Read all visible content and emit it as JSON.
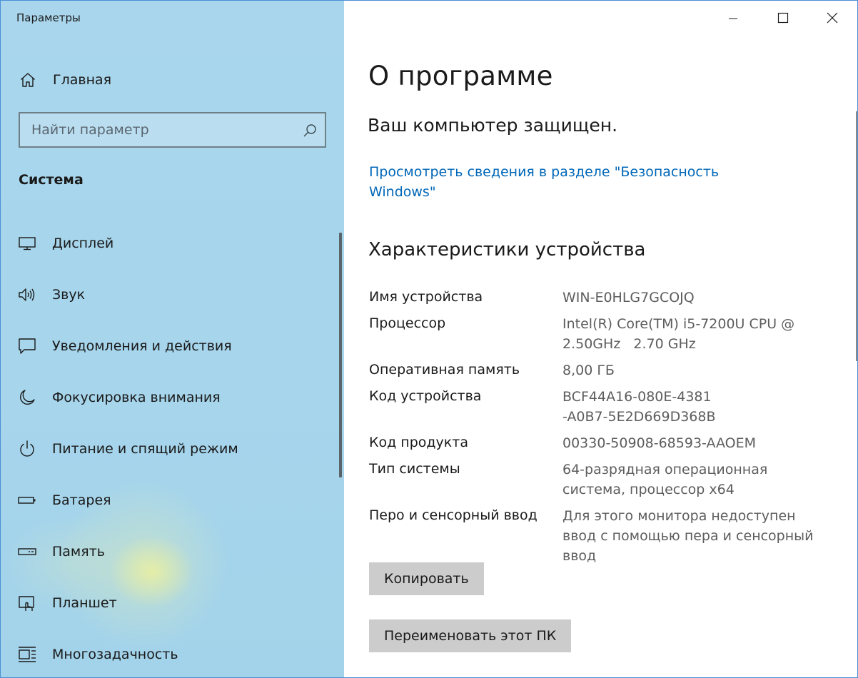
{
  "window": {
    "app_title": "Параметры"
  },
  "sidebar": {
    "home_label": "Главная",
    "search_placeholder": "Найти параметр",
    "section_title": "Система",
    "items": [
      {
        "label": "Дисплей",
        "icon": "display-icon"
      },
      {
        "label": "Звук",
        "icon": "speaker-icon"
      },
      {
        "label": "Уведомления и действия",
        "icon": "notification-icon"
      },
      {
        "label": "Фокусировка внимания",
        "icon": "moon-icon"
      },
      {
        "label": "Питание и спящий режим",
        "icon": "power-icon"
      },
      {
        "label": "Батарея",
        "icon": "battery-icon"
      },
      {
        "label": "Память",
        "icon": "storage-icon"
      },
      {
        "label": "Планшет",
        "icon": "tablet-icon"
      },
      {
        "label": "Многозадачность",
        "icon": "multitasking-icon"
      }
    ]
  },
  "main": {
    "title": "О программе",
    "protection_status": "Ваш компьютер защищен.",
    "security_link": "Просмотреть сведения в разделе \"Безопасность Windows\"",
    "specs_title": "Характеристики устройства",
    "specs": [
      {
        "label": "Имя устройства",
        "value": "WIN-E0HLG7GCOJQ"
      },
      {
        "label": "Процессор",
        "value": "Intel(R) Core(TM) i5-7200U CPU @ 2.50GHz   2.70 GHz"
      },
      {
        "label": "Оперативная память",
        "value": "8,00 ГБ"
      },
      {
        "label": "Код устройства",
        "value": "BCF44A16-080E-4381-A0B7-5E2D669D368B"
      },
      {
        "label": "Код продукта",
        "value": "00330-50908-68593-AAOEM"
      },
      {
        "label": "Тип системы",
        "value": "64-разрядная операционная система, процессор x64"
      },
      {
        "label": "Перо и сенсорный ввод",
        "value": "Для этого монитора недоступен ввод с помощью пера и сенсорный ввод"
      }
    ],
    "copy_button": "Копировать",
    "rename_button": "Переименовать этот ПК"
  },
  "colors": {
    "accent_link": "#0067b8",
    "sidebar_bg": "#a6d5ec",
    "button_bg": "#cccccc",
    "value_text": "#5d5d5d"
  }
}
